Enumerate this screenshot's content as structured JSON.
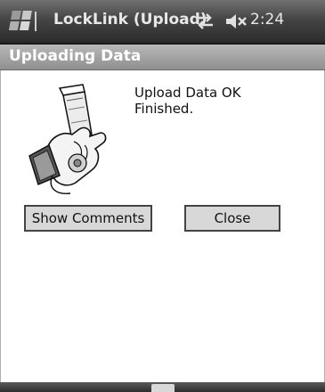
{
  "status_bar": {
    "title": "LockLink (Upload)",
    "clock": "2:24",
    "icons": [
      "windows-logo",
      "connectivity-icon",
      "volume-muted-icon"
    ]
  },
  "header": {
    "title": "Uploading Data"
  },
  "message": {
    "line1": "Upload Data OK",
    "line2": "Finished."
  },
  "buttons": {
    "show_comments": "Show Comments",
    "close": "Close"
  },
  "menu_bar": {
    "icons": [
      "keyboard-icon"
    ]
  }
}
